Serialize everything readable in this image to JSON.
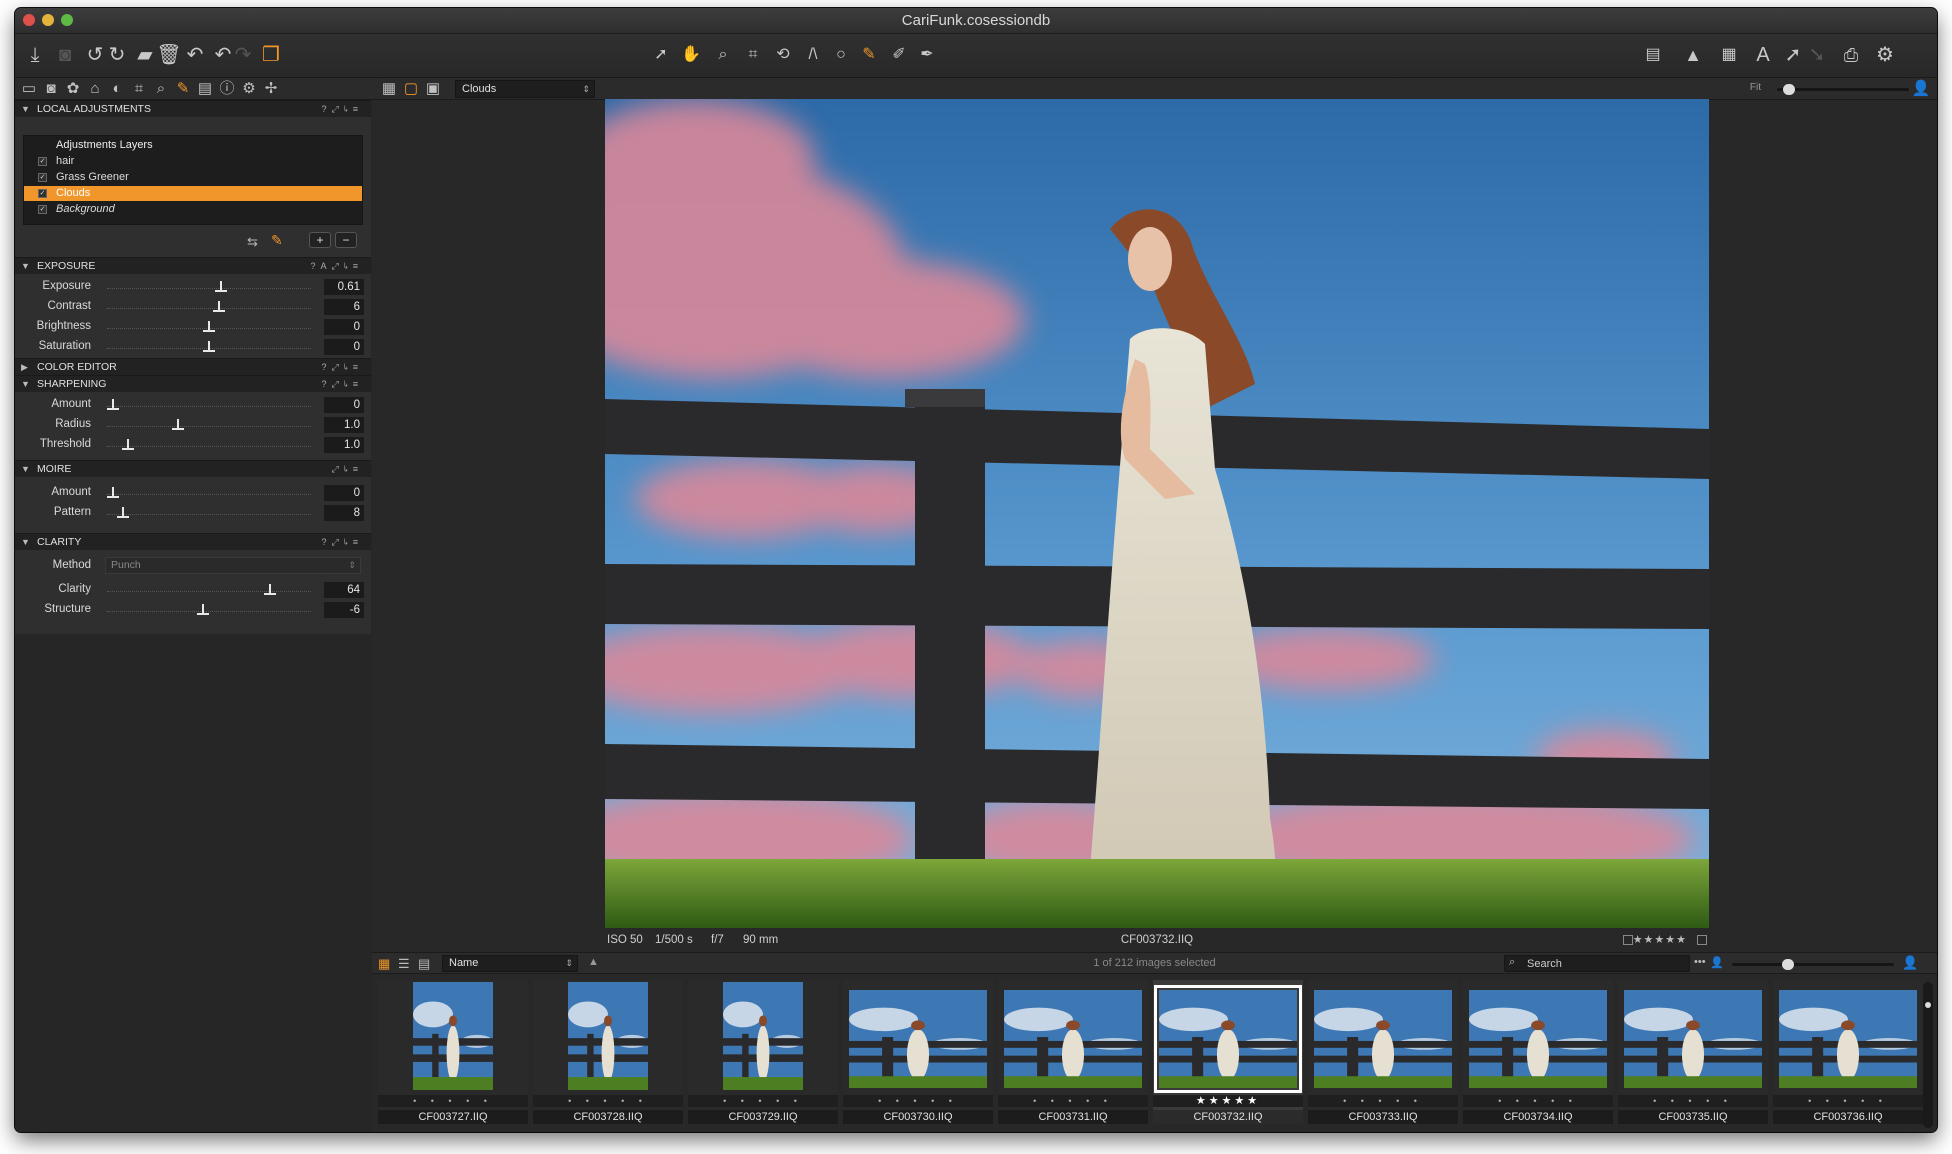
{
  "window": {
    "title": "CariFunk.cosessiondb"
  },
  "tools_row": {
    "view_preset": "Clouds",
    "zoom_label": "Fit"
  },
  "local_adjustments": {
    "header": "LOCAL ADJUSTMENTS",
    "layers": [
      {
        "name": "Adjustments Layers",
        "checked": false,
        "selected": false,
        "italic": false
      },
      {
        "name": "hair",
        "checked": true,
        "selected": false,
        "italic": false
      },
      {
        "name": "Grass Greener",
        "checked": true,
        "selected": false,
        "italic": false
      },
      {
        "name": "Clouds",
        "checked": true,
        "selected": true,
        "italic": false
      },
      {
        "name": "Background",
        "checked": true,
        "selected": false,
        "italic": true
      }
    ]
  },
  "exposure": {
    "header": "EXPOSURE",
    "rows": [
      {
        "label": "Exposure",
        "value": "0.61",
        "pos": 0.56
      },
      {
        "label": "Contrast",
        "value": "6",
        "pos": 0.55
      },
      {
        "label": "Brightness",
        "value": "0",
        "pos": 0.5
      },
      {
        "label": "Saturation",
        "value": "0",
        "pos": 0.5
      }
    ]
  },
  "color_editor": {
    "header": "COLOR EDITOR"
  },
  "sharpening": {
    "header": "SHARPENING",
    "rows": [
      {
        "label": "Amount",
        "value": "0",
        "pos": 0.0
      },
      {
        "label": "Radius",
        "value": "1.0",
        "pos": 0.34
      },
      {
        "label": "Threshold",
        "value": "1.0",
        "pos": 0.08
      }
    ]
  },
  "moire": {
    "header": "MOIRE",
    "rows": [
      {
        "label": "Amount",
        "value": "0",
        "pos": 0.0
      },
      {
        "label": "Pattern",
        "value": "8",
        "pos": 0.05
      }
    ]
  },
  "clarity": {
    "header": "CLARITY",
    "method_label": "Method",
    "method_value": "Punch",
    "rows": [
      {
        "label": "Clarity",
        "value": "64",
        "pos": 0.82
      },
      {
        "label": "Structure",
        "value": "-6",
        "pos": 0.47
      }
    ]
  },
  "viewer": {
    "iso": "ISO 50",
    "shutter": "1/500 s",
    "aperture": "f/7",
    "focal": "90 mm",
    "filename": "CF003732.IIQ",
    "rating": "★★★★★"
  },
  "browser": {
    "sort_label": "Name",
    "selection_status": "1 of 212 images selected",
    "search_placeholder": "Search",
    "thumbnails": [
      {
        "name": "CF003727.IIQ",
        "portrait": true,
        "stars": "• • • • •",
        "selected": false
      },
      {
        "name": "CF003728.IIQ",
        "portrait": true,
        "stars": "• • • • •",
        "selected": false
      },
      {
        "name": "CF003729.IIQ",
        "portrait": true,
        "stars": "• • • • •",
        "selected": false
      },
      {
        "name": "CF003730.IIQ",
        "portrait": false,
        "stars": "• • • • •",
        "selected": false
      },
      {
        "name": "CF003731.IIQ",
        "portrait": false,
        "stars": "• • • • •",
        "selected": false
      },
      {
        "name": "CF003732.IIQ",
        "portrait": false,
        "stars": "★★★★★",
        "selected": true
      },
      {
        "name": "CF003733.IIQ",
        "portrait": false,
        "stars": "• • • • •",
        "selected": false
      },
      {
        "name": "CF003734.IIQ",
        "portrait": false,
        "stars": "• • • • •",
        "selected": false
      },
      {
        "name": "CF003735.IIQ",
        "portrait": false,
        "stars": "• • • • •",
        "selected": false
      },
      {
        "name": "CF003736.IIQ",
        "portrait": false,
        "stars": "• • • • •",
        "selected": false
      }
    ]
  },
  "colors": {
    "accent": "#f0962a",
    "background": "#262626",
    "sky": "#3d78b4",
    "mask": "#d9889a"
  }
}
